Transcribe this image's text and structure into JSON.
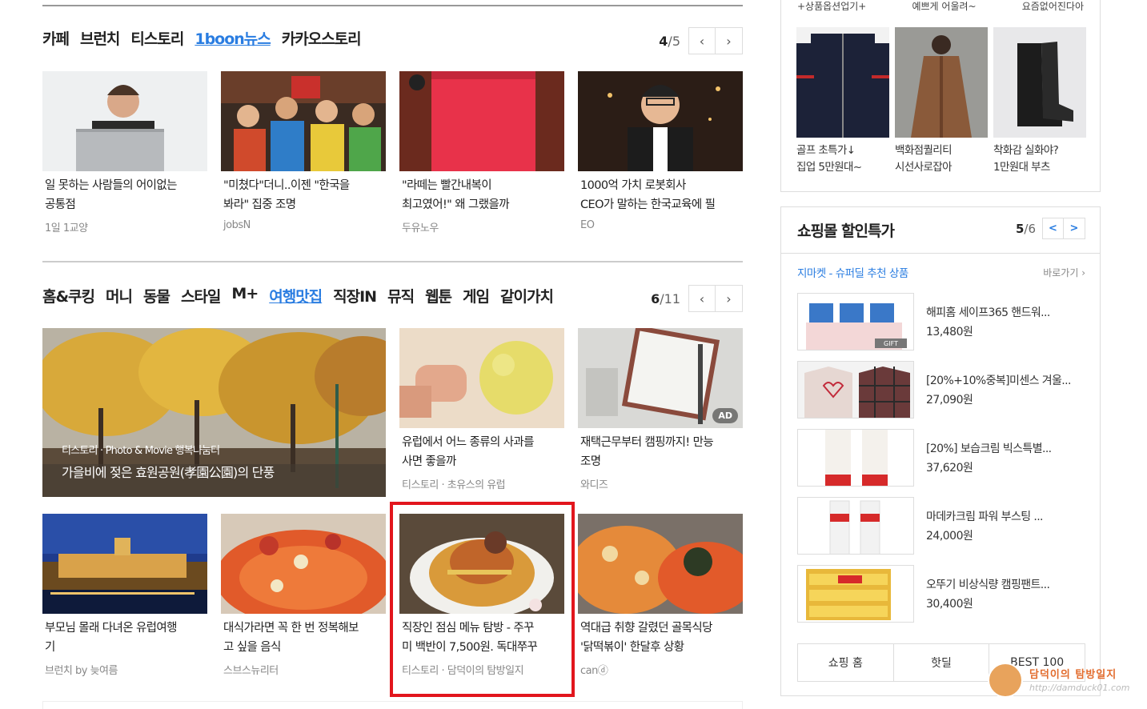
{
  "section1": {
    "tabs": [
      "카페",
      "브런치",
      "티스토리",
      "1boon뉴스",
      "카카오스토리"
    ],
    "active_tab": "1boon뉴스",
    "page_current": "4",
    "page_total": "/5",
    "prev_icon": "chevron-left-icon",
    "next_icon": "chevron-right-icon",
    "cards": [
      {
        "title_1": "일 못하는 사람들의 어이없는",
        "title_2": "공통점",
        "source": "1일 1교양"
      },
      {
        "title_1": "\"미쳤다\"더니..이젠 \"한국을",
        "title_2": "봐라\" 집중 조명",
        "source": "jobsN"
      },
      {
        "title_1": "\"라떼는 빨간내복이",
        "title_2": "최고였어!\" 왜 그랬을까",
        "source": "두유노우"
      },
      {
        "title_1": "1000억 가치 로봇회사",
        "title_2": "CEO가 말하는 한국교육에 필",
        "source": "EO"
      }
    ]
  },
  "section2": {
    "tabs": [
      "홈&쿠킹",
      "머니",
      "동물",
      "스타일",
      "M+",
      "여행맛집",
      "직장IN",
      "뮤직",
      "웹툰",
      "게임",
      "같이가치"
    ],
    "active_tab": "여행맛집",
    "page_current": "6",
    "page_total": "/11",
    "big_card": {
      "source": "티스토리 · Photo & Movie 행복나눔터",
      "title": "가을비에 젖은 효원공원(孝園公園)의 단풍"
    },
    "cards_top": [
      {
        "title_1": "유럽에서 어느 종류의 사과를",
        "title_2": "사면 좋을까",
        "source": "티스토리 · 초유스의 유럽"
      },
      {
        "title_1": "재택근무부터 캠핑까지! 만능",
        "title_2": "조명",
        "source": "와디즈",
        "badge": "AD"
      }
    ],
    "cards_bottom": [
      {
        "title_1": "부모님 몰래 다녀온 유럽여행",
        "title_2": "기",
        "source": "브런치 by 늦여름"
      },
      {
        "title_1": "대식가라면 꼭 한 번 정복해보",
        "title_2": "고 싶을 음식",
        "source": "스브스뉴리터"
      },
      {
        "title_1": "직장인 점심 메뉴 탐방 - 주꾸",
        "title_2": "미 백반이 7,500원. 독대쭈꾸",
        "source": "티스토리 · 담덕이의 탐방일지"
      },
      {
        "title_1": "역대급 취향 갈렸던 골목식당",
        "title_2": "'닭떡볶이' 한달후 상황",
        "source": "canⓓ"
      }
    ]
  },
  "sidebar_fashion": {
    "cats": [
      "+상품옵션업기+",
      "예쁘게 어울려~",
      "요즘없어진다아"
    ],
    "items": [
      {
        "line1": "골프 초특가↓",
        "line2": "집업 5만원대~"
      },
      {
        "line1": "백화점퀄리티",
        "line2": "시선사로잡아"
      },
      {
        "line1": "착화감 실화야?",
        "line2": "1만원대 부츠"
      }
    ]
  },
  "shopping": {
    "title": "쇼핑몰 할인특가",
    "page_current": "5",
    "page_total": "/6",
    "subtitle": "지마켓 - 슈퍼딜 추천 상품",
    "go_label": "바로가기 ›",
    "gift_label": "GIFT",
    "items": [
      {
        "name": "해피홈 세이프365 핸드워...",
        "price": "13,480원"
      },
      {
        "name": "[20%+10%중복]미센스 겨울...",
        "price": "27,090원"
      },
      {
        "name": "[20%] 보습크림 빅스특별...",
        "price": "37,620원"
      },
      {
        "name": "마데카크림 파워 부스팅 ...",
        "price": "24,000원"
      },
      {
        "name": "오뚜기 비상식량 캠핑팬트...",
        "price": "30,400원"
      }
    ],
    "footer": [
      "쇼핑 홈",
      "핫딜",
      "BEST 100"
    ]
  },
  "watermark": {
    "name": "담덕이의 탐방일지",
    "url": "http://damduck01.com"
  },
  "colors": {
    "accent": "#2a7de1",
    "highlight": "#e2161d"
  }
}
